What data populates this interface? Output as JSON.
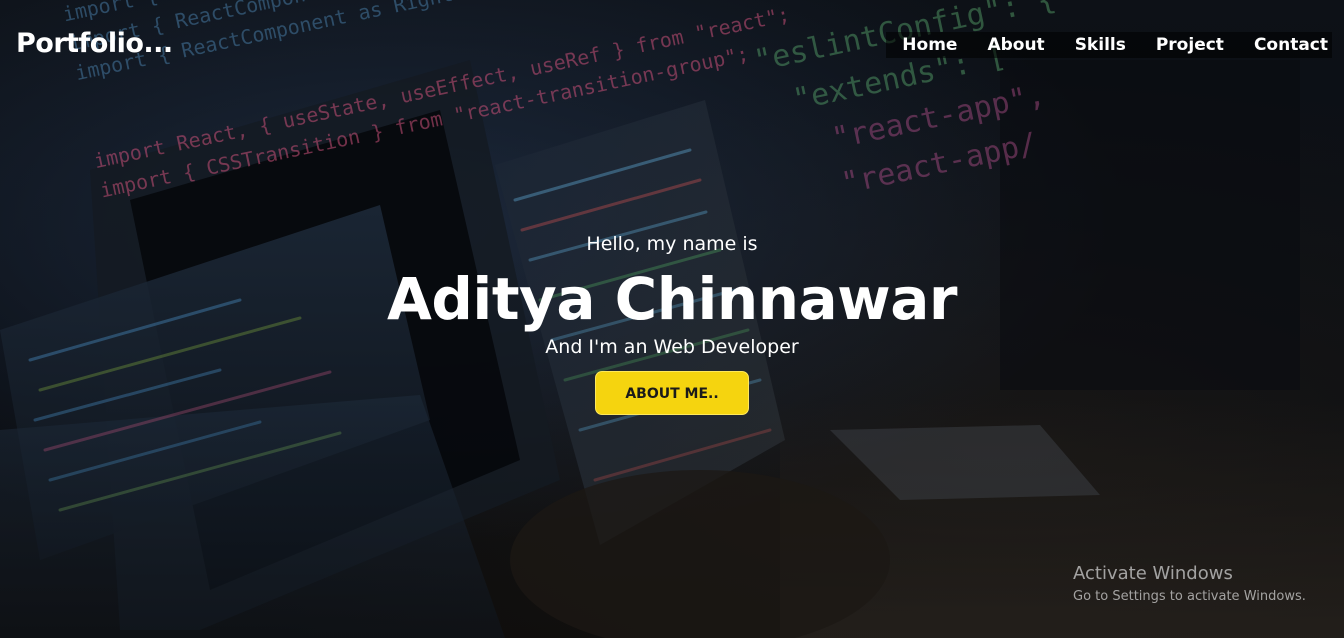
{
  "nav": {
    "logo": "Portfolio...",
    "links": [
      "Home",
      "About",
      "Skills",
      "Project",
      "Contact"
    ]
  },
  "hero": {
    "greeting": "Hello, my name is",
    "name": "Aditya Chinnawar",
    "role": "And I'm an Web Developer",
    "button_label": "ABOUT ME.."
  },
  "background": {
    "code_left": [
      "import { ReactComponent as ArrowIcon } from \"../assets/icons/bolt.svg\";",
      "import { ReactComponent as BoltIcon } from \"../assets/icons/right-arrow.svg\";",
      "import { ReactComponent as RightArrowIcon } from \"../assets/",
      "import React, { useState, useEffect, useRef } from \"react\";",
      "import { CSSTransition } from \"react-transition-group\";"
    ],
    "code_right": [
      "\"eslintConfig\": {",
      "\"extends\": [",
      "\"react-app\",",
      "\"react-app/"
    ]
  },
  "watermark": {
    "title": "Activate Windows",
    "subtitle": "Go to Settings to activate Windows."
  },
  "colors": {
    "accent": "#f5d40f",
    "text": "#ffffff",
    "background": "#0b0f14"
  }
}
